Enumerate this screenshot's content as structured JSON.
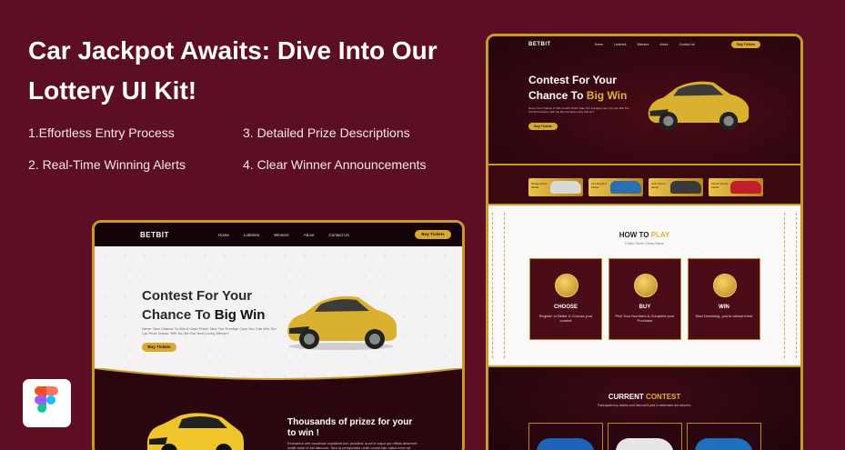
{
  "hero": {
    "title": "Car Jackpot Awaits: Dive Into Our Lottery UI Kit!",
    "features": [
      "1.Effortless Entry Process",
      "3. Detailed Prize Descriptions",
      "2. Real-Time Winning Alerts",
      "4. Clear Winner Announcements"
    ]
  },
  "mockup_left": {
    "logo": "BETBIT",
    "nav": [
      "Home",
      "Lotteries",
      "Winners",
      "About",
      "Contact Us"
    ],
    "buy_button": "Buy Tickets",
    "headline_1": "Contest For Your",
    "headline_2": "Chance To",
    "headline_highlight": "Big Win",
    "description": "Never Your Chance To Win A Cash Prize! Take The Prestige Cars You Can Win Our Car Prize Draws, Will You Be Our Next Lucky Winner?",
    "cta": "Buy Tickets",
    "section2_title": "Thousands of prizez for your",
    "section2_title_2": "to win !",
    "section2_text": "Excepteur sint occaecat cupidatat non proident, sunt in culpa qui officia deserunt mollit anim id est laborum. Sed ut perspiciatis unde omnis iste natus error sit voluptatem."
  },
  "mockup_right": {
    "logo": "BETBIT",
    "nav": [
      "Home",
      "Lotteries",
      "Winners",
      "About",
      "Contact Us"
    ],
    "buy_button": "Buy Tickets",
    "headline_1": "Contest For Your",
    "headline_2": "Chance To",
    "headline_highlight": "Big Win",
    "description": "Never Your Chance To Win A Cash Prize! Take The Prestige Cars You Can Win Our Car Prize Draws, Will You Be Our Next Lucky Winner?",
    "cta": "Buy Tickets",
    "tickets": [
      {
        "label": "Range Rover Model",
        "car_color": "#d8d8d8"
      },
      {
        "label": "Lamborghini Model",
        "car_color": "#2a6fb3"
      },
      {
        "label": "Audi Sports Model",
        "car_color": "#3a3a3a"
      },
      {
        "label": "Ferrari Sports Model",
        "car_color": "#c01e2a"
      }
    ],
    "how_to_play_title": "HOW TO",
    "how_to_play_highlight": "PLAY",
    "how_to_play_sub": "Follow These 3 Easy Steps!",
    "steps": [
      {
        "title": "CHOOSE",
        "text": "Register to Better & Choose your contest"
      },
      {
        "title": "BUY",
        "text": "Pick Your Numbers & Complete your Purchase"
      },
      {
        "title": "WIN",
        "text": "Start Dreaming, you're almost there"
      }
    ],
    "contest_title": "CURRENT",
    "contest_highlight": "CONTEST",
    "contest_sub": "Participate buy tickets and then we'll pick & determine the winners.",
    "contest_cars": [
      "#1f63b8",
      "#e6e6e6",
      "#1f6fbd"
    ]
  },
  "colors": {
    "background": "#5c0f22",
    "gold": "#c79a2c",
    "car_yellow": "#d9b12f"
  }
}
